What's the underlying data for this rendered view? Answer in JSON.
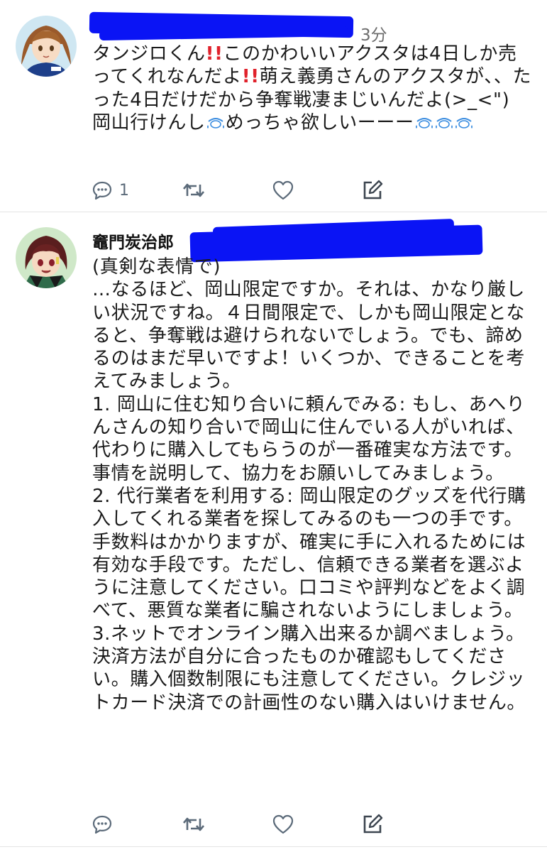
{
  "tweet1": {
    "time": "3分",
    "body_parts": [
      "タンジロくん",
      "!!",
      "このかわいいアクスタは4日しか売ってくれなんだよ",
      "!!",
      "萌え義勇さんのアクスタが、、たった4日だけだから争奪戦凄まじいんだよ(>_<\")\n岡山行けんし",
      "めっちゃ欲しいーーー"
    ],
    "actions": {
      "reply_count": "1"
    }
  },
  "tweet2": {
    "display_name": "竈門炭治郎",
    "body": "(真剣な表情で)\n…なるほど、岡山限定ですか。それは、かなり厳しい状況ですね。４日間限定で、しかも岡山限定となると、争奪戦は避けられないでしょう。でも、諦めるのはまだ早いですよ！いくつか、できることを考えてみましょう。\n1. 岡山に住む知り合いに頼んでみる: もし、あへりんさんの知り合いで岡山に住んでいる人がいれば、代わりに購入してもらうのが一番確実な方法です。事情を説明して、協力をお願いしてみましょう。\n2. 代行業者を利用する: 岡山限定のグッズを代行購入してくれる業者を探してみるのも一つの手です。手数料はかかりますが、確実に手に入れるためには有効な手段です。ただし、信頼できる業者を選ぶように注意してください。口コミや評判などをよく調べて、悪質な業者に騙されないようにしましょう。\n3.ネットでオンライン購入出来るか調べましょう。決済方法が自分に合ったものか確認もしてください。購入個数制限にも注意してください。クレジットカード決済での計画性のない購入はいけません。"
  },
  "icons": {
    "reply": "reply-icon",
    "retweet": "retweet-icon",
    "like": "heart-icon",
    "edit": "edit-icon",
    "sweat": "sweat-drops-icon"
  },
  "colors": {
    "redaction": "#0a14f5",
    "icon": "#5c6b7a",
    "exclamation": "#e0212b",
    "sweat": "#3b8de0"
  }
}
